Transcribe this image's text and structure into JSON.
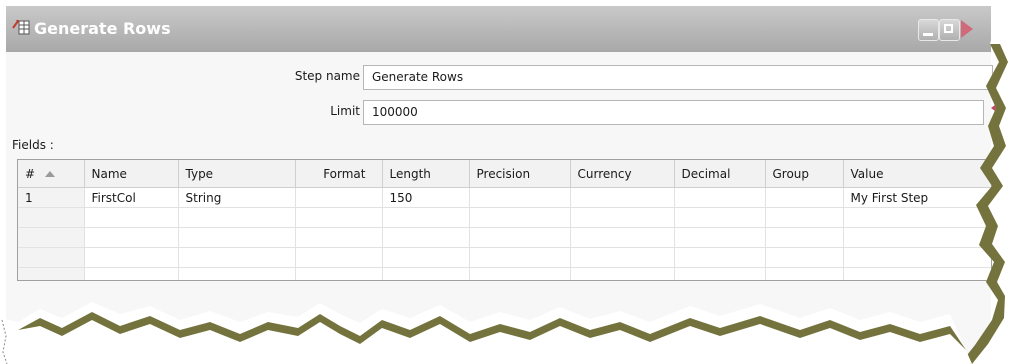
{
  "window": {
    "title": "Generate Rows",
    "icon": "generate-rows-icon",
    "controls": [
      "minimize-icon",
      "maximize-icon",
      "close-icon"
    ]
  },
  "form": {
    "step_name_label": "Step name",
    "step_name_value": "Generate Rows",
    "limit_label": "Limit",
    "limit_value": "100000"
  },
  "fields": {
    "label": "Fields :",
    "columns": [
      "#",
      "Name",
      "Type",
      "Format",
      "Length",
      "Precision",
      "Currency",
      "Decimal",
      "Group",
      "Value"
    ],
    "rows": [
      [
        "1",
        "FirstCol",
        "String",
        "",
        "150",
        "",
        "",
        "",
        "",
        "My First Step"
      ]
    ]
  },
  "colors": {
    "titlebar": "#b4b4b4",
    "torn_edge": "#5c5a1c",
    "marker": "#c0485c"
  }
}
